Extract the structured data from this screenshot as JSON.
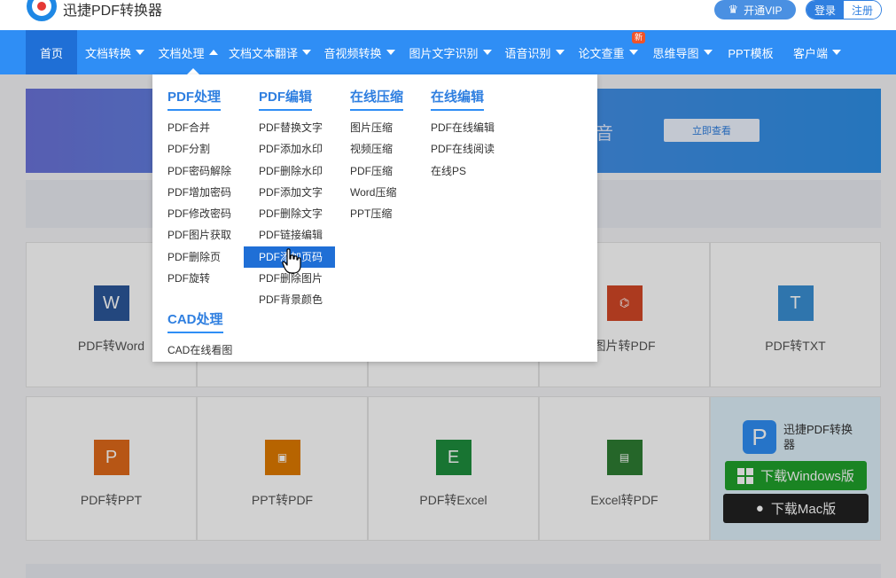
{
  "brand": {
    "name": "迅捷PDF转换器"
  },
  "header": {
    "vip_label": "开通VIP",
    "login_label": "登录",
    "register_label": "注册"
  },
  "nav": {
    "items": [
      {
        "label": "首页",
        "caret": "none"
      },
      {
        "label": "文档转换",
        "caret": "down"
      },
      {
        "label": "文档处理",
        "caret": "up"
      },
      {
        "label": "文档文本翻译",
        "caret": "down"
      },
      {
        "label": "音视频转换",
        "caret": "down"
      },
      {
        "label": "图片文字识别",
        "caret": "down"
      },
      {
        "label": "语音识别",
        "caret": "down"
      },
      {
        "label": "论文查重",
        "caret": "down",
        "badge": "新"
      },
      {
        "label": "思维导图",
        "caret": "down"
      },
      {
        "label": "PPT模板",
        "caret": "none"
      },
      {
        "label": "客户端",
        "caret": "down"
      }
    ]
  },
  "banner": {
    "title_fragment": "音",
    "button_label": "立即查看"
  },
  "dropdown": {
    "columns": [
      {
        "title": "PDF处理",
        "items": [
          "PDF合并",
          "PDF分割",
          "PDF密码解除",
          "PDF增加密码",
          "PDF修改密码",
          "PDF图片获取",
          "PDF删除页",
          "PDF旋转"
        ]
      },
      {
        "title": "PDF编辑",
        "items": [
          "PDF替换文字",
          "PDF添加水印",
          "PDF删除水印",
          "PDF添加文字",
          "PDF删除文字",
          "PDF链接编辑",
          "PDF添加页码",
          "PDF删除图片",
          "PDF背景颜色"
        ],
        "highlighted_index": 6
      },
      {
        "title": "在线压缩",
        "items": [
          "图片压缩",
          "视频压缩",
          "PDF压缩",
          "Word压缩",
          "PPT压缩"
        ]
      },
      {
        "title": "在线编辑",
        "items": [
          "PDF在线编辑",
          "PDF在线阅读",
          "在线PS"
        ]
      },
      {
        "title": "CAD处理",
        "items": [
          "CAD在线看图"
        ]
      }
    ]
  },
  "tiles": [
    {
      "label": "PDF转Word",
      "icon": "W",
      "color": "#2b579a"
    },
    {
      "label": "图片转PDF",
      "icon": "pdf",
      "color": "#d24726"
    },
    {
      "label": "PDF转TXT",
      "icon": "T",
      "color": "#3a8fd4"
    },
    {
      "label": "PDF转PPT",
      "icon": "P",
      "color": "#e06a1a"
    },
    {
      "label": "PPT转PDF",
      "icon": "pdf",
      "color": "#e07a00"
    },
    {
      "label": "PDF转Excel",
      "icon": "E",
      "color": "#1e8e3e"
    },
    {
      "label": "Excel转PDF",
      "icon": "pdf",
      "color": "#2e7d32"
    }
  ],
  "download": {
    "app_name": "迅捷PDF转换器",
    "windows_label": "下载Windows版",
    "mac_label": "下载Mac版"
  }
}
